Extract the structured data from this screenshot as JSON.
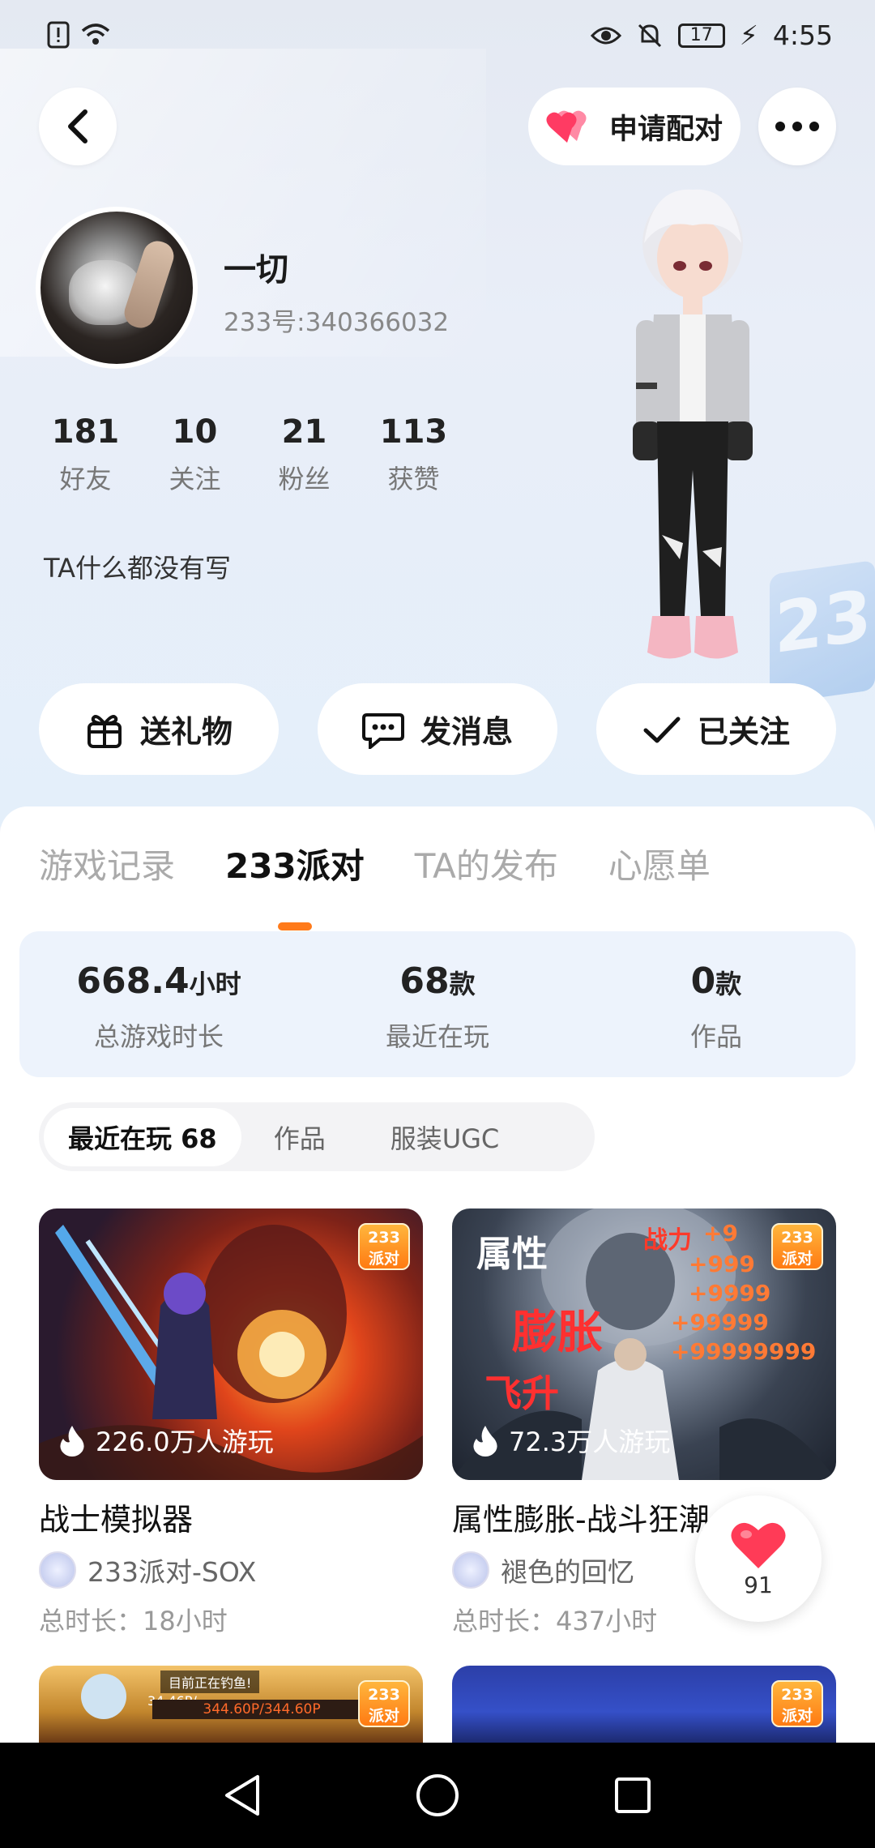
{
  "status_bar": {
    "time": "4:55",
    "battery": "17"
  },
  "header": {
    "pair_label": "申请配对"
  },
  "profile": {
    "name": "一切",
    "uid": "233号:340366032",
    "bio": "TA什么都没有写",
    "stats": [
      {
        "value": "181",
        "label": "好友"
      },
      {
        "value": "10",
        "label": "关注"
      },
      {
        "value": "21",
        "label": "粉丝"
      },
      {
        "value": "113",
        "label": "获赞"
      }
    ]
  },
  "actions": {
    "gift_label": "送礼物",
    "message_label": "发消息",
    "follow_label": "已关注"
  },
  "tabs": [
    "游戏记录",
    "233派对",
    "TA的发布",
    "心愿单"
  ],
  "active_tab": "233派对",
  "summary": [
    {
      "value": "668.4",
      "unit": "小时",
      "label": "总游戏时长"
    },
    {
      "value": "68",
      "unit": "款",
      "label": "最近在玩"
    },
    {
      "value": "0",
      "unit": "款",
      "label": "作品"
    }
  ],
  "filters": [
    "最近在玩 68",
    "作品",
    "服装UGC"
  ],
  "badge": {
    "line1": "233",
    "line2": "派对"
  },
  "games": [
    {
      "title": "战士模拟器",
      "plays": "226.0万人游玩",
      "author": "233派对-SOX",
      "duration": "总时长：18小时"
    },
    {
      "title": "属性膨胀-战斗狂潮",
      "plays": "72.3万人游玩",
      "author": "褪色的回忆",
      "duration": "总时长：437小时",
      "art_text": {
        "attr": "属性",
        "inflate": "膨胀",
        "ascend": "飞升",
        "power": "战力",
        "numbers": [
          "+9",
          "+999",
          "+9999",
          "+99999",
          "+99999999"
        ]
      }
    }
  ],
  "game3_overlay": {
    "top": "目前正在钓鱼!",
    "progress": "344.60P/344.60P",
    "small": "34.46P/..."
  },
  "like": {
    "count": "91"
  },
  "colors": {
    "accent": "#ff7a1a",
    "heart": "#ff3b57"
  }
}
